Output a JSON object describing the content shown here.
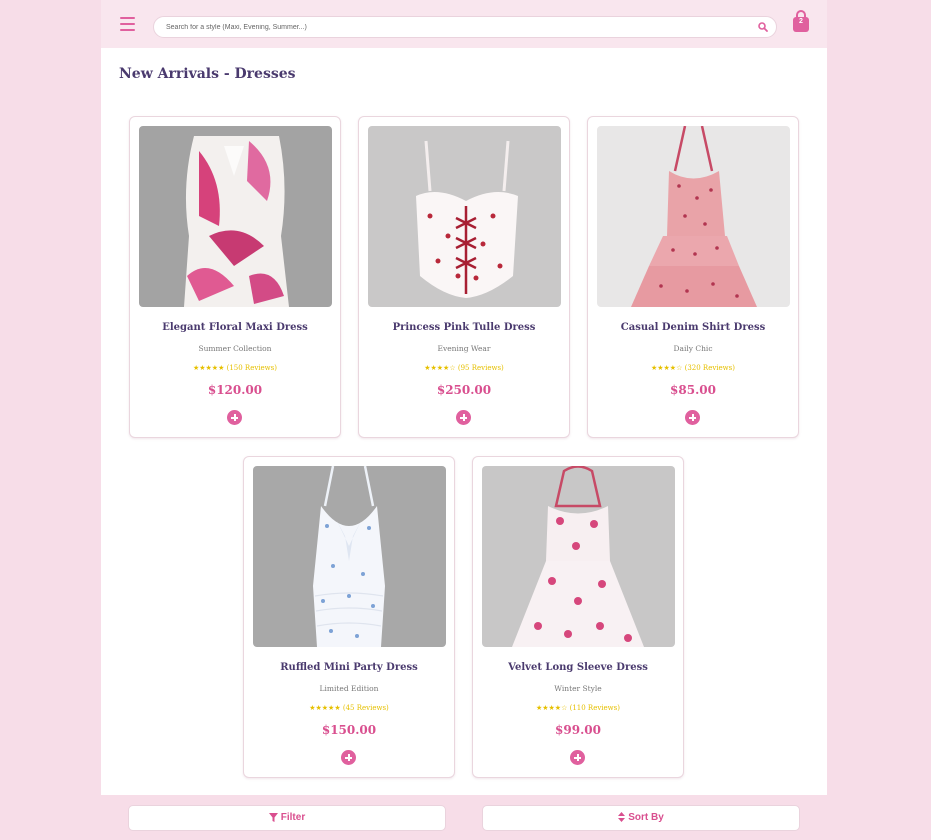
{
  "header": {
    "menu_icon": "hamburger-icon",
    "search_placeholder": "Search for a style (Maxi, Evening, Summer...)",
    "search_icon": "search-icon",
    "cart_icon": "shopping-bag-icon",
    "cart_count": "2",
    "accent_color": "#e0609e"
  },
  "page": {
    "title": "New Arrivals - Dresses"
  },
  "products": [
    {
      "name": "Elegant Floral Maxi Dress",
      "category": "Summer Collection",
      "stars": "★★★★★",
      "reviews": "(150 Reviews)",
      "price": "$120.00"
    },
    {
      "name": "Princess Pink Tulle Dress",
      "category": "Evening Wear",
      "stars": "★★★★☆",
      "reviews": "(95 Reviews)",
      "price": "$250.00"
    },
    {
      "name": "Casual Denim Shirt Dress",
      "category": "Daily Chic",
      "stars": "★★★★☆",
      "reviews": "(320 Reviews)",
      "price": "$85.00"
    },
    {
      "name": "Ruffled Mini Party Dress",
      "category": "Limited Edition",
      "stars": "★★★★★",
      "reviews": "(45 Reviews)",
      "price": "$150.00"
    },
    {
      "name": "Velvet Long Sleeve Dress",
      "category": "Winter Style",
      "stars": "★★★★☆",
      "reviews": "(110 Reviews)",
      "price": "$99.00"
    }
  ],
  "footer": {
    "filter_label": "Filter",
    "filter_icon": "filter-icon",
    "sort_label": "Sort By",
    "sort_icon": "sort-icon"
  }
}
